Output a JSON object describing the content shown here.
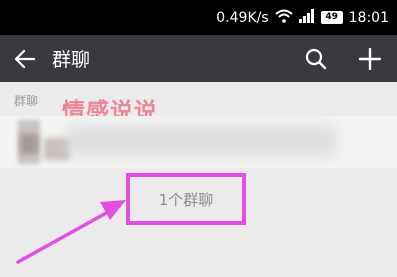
{
  "status_bar": {
    "speed": "0.49K/s",
    "battery": "49",
    "time": "18:01"
  },
  "toolbar": {
    "title": "群聊",
    "back_icon": "arrow-left-icon",
    "search_icon": "search-icon",
    "add_icon": "plus-icon"
  },
  "section": {
    "label": "群聊"
  },
  "watermark": {
    "text": "情感说说"
  },
  "group_count": {
    "text": "1个群聊"
  },
  "colors": {
    "toolbar_bg": "#393a3f",
    "highlight": "#e34fe3",
    "background": "#ebebeb"
  }
}
